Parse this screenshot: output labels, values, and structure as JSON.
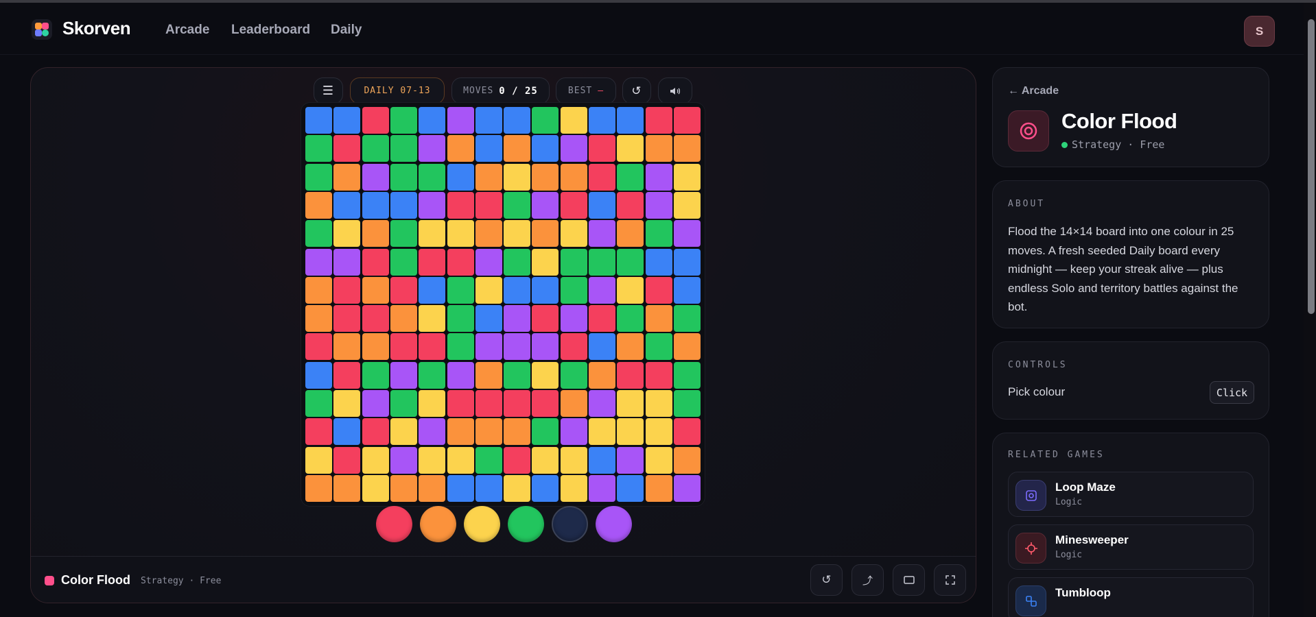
{
  "header": {
    "brand": "Skorven",
    "nav": [
      "Arcade",
      "Leaderboard",
      "Daily"
    ],
    "avatar_initial": "S"
  },
  "toolbar": {
    "menu_icon": "menu-icon",
    "daily_label": "DAILY 07-13",
    "moves_label": "MOVES",
    "moves_value": "0 / 25",
    "best_label": "BEST",
    "best_value": "—",
    "restart_icon": "restart-icon",
    "sound_icon": "speaker-icon"
  },
  "board": {
    "size": 14,
    "palette": {
      "R": "#f43f5e",
      "O": "#fb923c",
      "Y": "#fcd34d",
      "G": "#22c55e",
      "B": "#3b82f6",
      "P": "#a855f7"
    },
    "rows": [
      "BBRGBPBBGYBBRR",
      "GRGGPOBOBPRYOO",
      "GOPGGBOYOORGPY",
      "OBBBPRRGPRBRPY",
      "GYOGYYOYOYPOGP",
      "PPRGRRPGYGGGBB",
      "ORORBGYBBGPYRB",
      "ORROYGBPRPRGOG",
      "ROORRGPPPRBOGO",
      "BRGPGPOGYGORRG",
      "GYPGYRRRROPYYG",
      "RBRYPOOOGPYYYR",
      "YRYPYYGRYYBPYO",
      "OOYOOBBYBYPBOP"
    ]
  },
  "palette_buttons": [
    {
      "name": "red",
      "color": "#f43f5e"
    },
    {
      "name": "orange",
      "color": "#fb923c"
    },
    {
      "name": "yellow",
      "color": "#fcd34d"
    },
    {
      "name": "green",
      "color": "#22c55e"
    },
    {
      "name": "current-blue",
      "color": "#1e2a4a"
    },
    {
      "name": "purple",
      "color": "#a855f7"
    }
  ],
  "game_footer": {
    "title": "Color Flood",
    "meta": "Strategy · Free",
    "buttons": [
      "restart-icon",
      "share-icon",
      "theater-icon",
      "fullscreen-icon"
    ]
  },
  "sidebar": {
    "back_link": "← Arcade",
    "game_title": "Color Flood",
    "game_sub": "Strategy · Free",
    "about_label": "ABOUT",
    "about_text": "Flood the 14×14 board into one colour in 25 moves. A fresh seeded Daily board every midnight — keep your streak alive — plus endless Solo and territory battles against the bot.",
    "controls_label": "CONTROLS",
    "controls": [
      {
        "action": "Pick colour",
        "key": "Click"
      }
    ],
    "related_label": "RELATED GAMES",
    "related": [
      {
        "name": "Loop Maze",
        "category": "Logic",
        "icon": "loop-icon",
        "color": "#7c6cff"
      },
      {
        "name": "Minesweeper",
        "category": "Logic",
        "icon": "crosshair-icon",
        "color": "#ff5a6b"
      },
      {
        "name": "Tumbloop",
        "category": "",
        "icon": "blocks-icon",
        "color": "#3b82f6"
      }
    ]
  }
}
